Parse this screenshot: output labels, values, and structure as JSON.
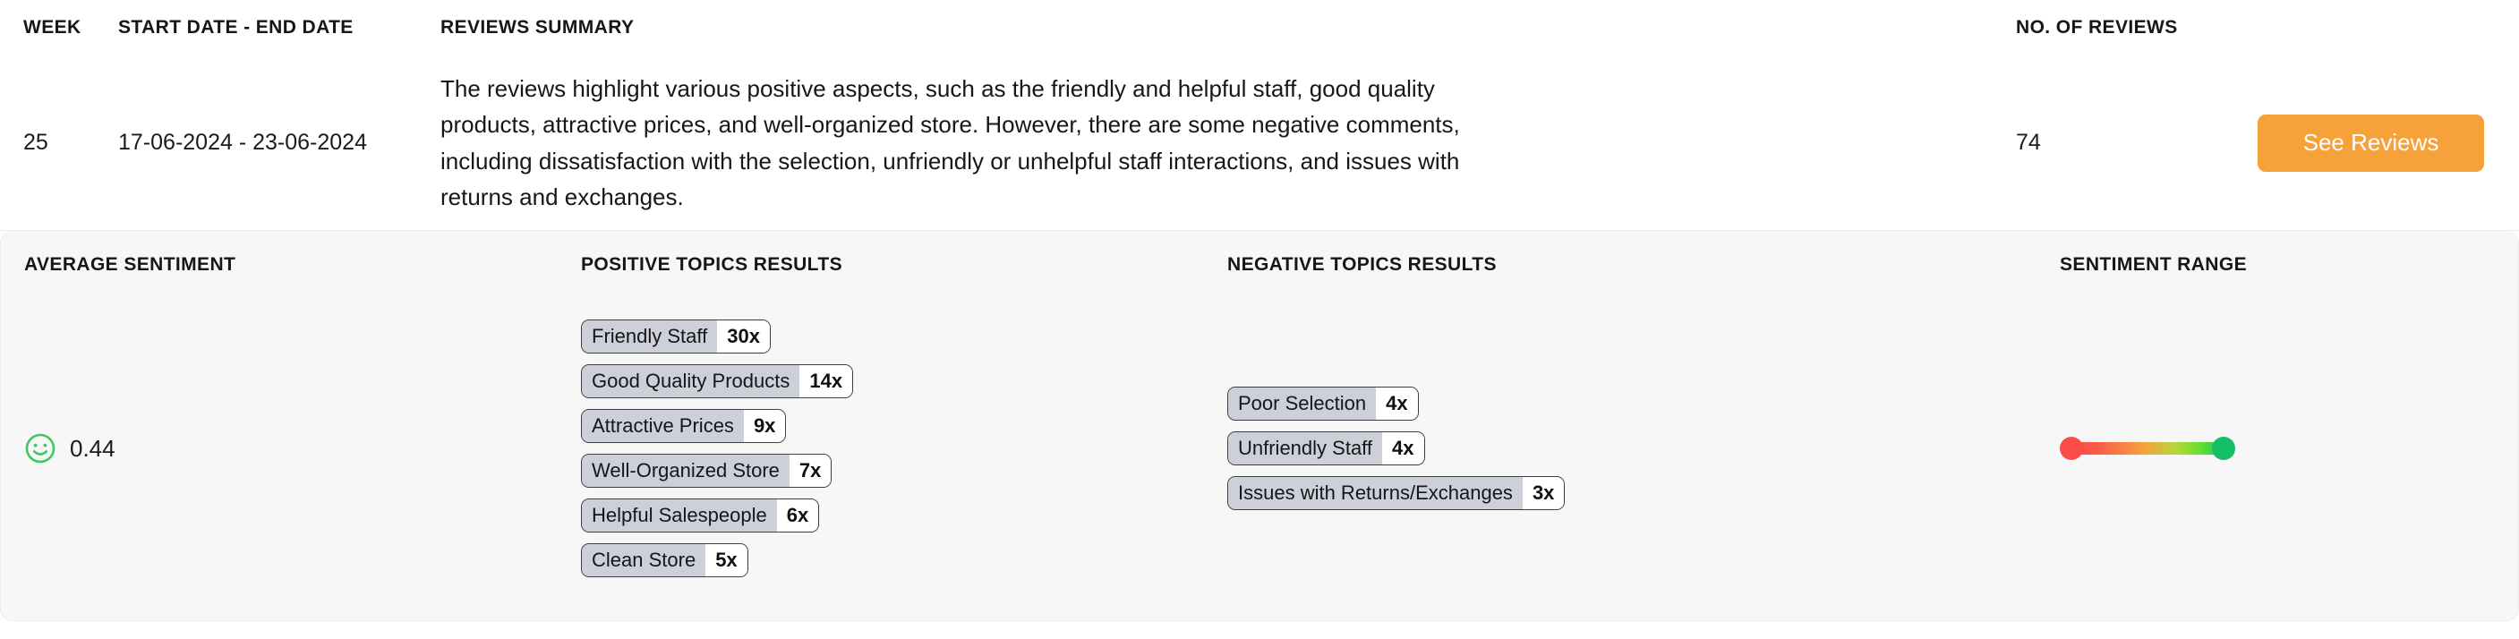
{
  "table": {
    "headers": {
      "week": "WEEK",
      "dates": "START DATE - END DATE",
      "summary": "REVIEWS SUMMARY",
      "count": "NO. OF REVIEWS",
      "action": ""
    },
    "row": {
      "week": "25",
      "dates": "17-06-2024 - 23-06-2024",
      "summary": "The reviews highlight various positive aspects, such as the friendly and helpful staff, good quality products, attractive prices, and well-organized store. However, there are some negative comments, including dissatisfaction with the selection, unfriendly or unhelpful staff interactions, and issues with returns and exchanges.",
      "count": "74",
      "see_reviews_label": "See Reviews"
    }
  },
  "detail": {
    "headers": {
      "average_sentiment": "AVERAGE SENTIMENT",
      "positive_topics": "POSITIVE TOPICS RESULTS",
      "negative_topics": "NEGATIVE TOPICS RESULTS",
      "sentiment_range": "SENTIMENT RANGE"
    },
    "average_sentiment": {
      "icon": "smiley-happy-icon",
      "value": "0.44",
      "icon_color": "#3ec862"
    },
    "positive_topics": [
      {
        "label": "Friendly Staff",
        "count": "30x"
      },
      {
        "label": "Good Quality Products",
        "count": "14x"
      },
      {
        "label": "Attractive Prices",
        "count": "9x"
      },
      {
        "label": "Well-Organized Store",
        "count": "7x"
      },
      {
        "label": "Helpful Salespeople",
        "count": "6x"
      },
      {
        "label": "Clean Store",
        "count": "5x"
      }
    ],
    "negative_topics": [
      {
        "label": "Poor Selection",
        "count": "4x"
      },
      {
        "label": "Unfriendly Staff",
        "count": "4x"
      },
      {
        "label": "Issues with Returns/Exchanges",
        "count": "3x"
      }
    ],
    "sentiment_range": {
      "low_color": "#fb4c47",
      "high_color": "#14bf67",
      "low_label": "negative",
      "high_label": "positive"
    }
  },
  "colors": {
    "accent": "#f7a13a",
    "tag_bg": "#cdd0d8",
    "card_bg": "#f7f7f8"
  }
}
